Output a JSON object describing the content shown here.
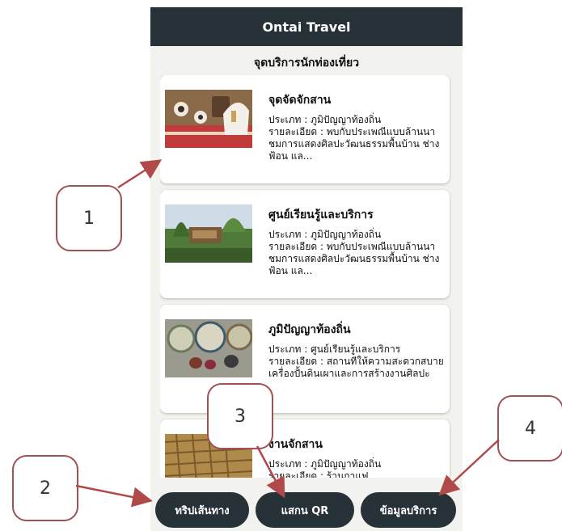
{
  "app": {
    "title": "Ontai Travel"
  },
  "section_title": "จุดบริการนักท่องเที่ยว",
  "cards": [
    {
      "title": "จุดจัดจักสาน",
      "type": "ประเภท : ภูมิปัญญาท้องถิ่น",
      "detail": "รายละเอียด : พบกับประเพณีแบบล้านนา ชมการแสดงศิลปะวัฒนธรรมพื้นบ้าน ช่างฟ้อน แล..."
    },
    {
      "title": "ศูนย์เรียนรู้และบริการ",
      "type": "ประเภท : ภูมิปัญญาท้องถิ่น",
      "detail": "รายละเอียด : พบกับประเพณีแบบล้านนา ชมการแสดงศิลปะวัฒนธรรมพื้นบ้าน ช่างฟ้อน แล..."
    },
    {
      "title": "ภูมิปัญญาท้องถิ่น",
      "type": "ประเภท : ศูนย์เรียนรู้และบริการ",
      "detail": "รายละเอียด : สถานที่ให้ความสะดวกสบาย เครื่องปั้นดินเผาและการสร้างงานศิลปะ"
    },
    {
      "title": "งานจักสาน",
      "type": "ประเภท : ภูมิปัญญาท้องถิ่น",
      "detail": "รายละเอียด : ร้านกาแฟ"
    }
  ],
  "nav": {
    "trip": "ทริปเส้นทาง",
    "scan": "แสกน QR",
    "info": "ข้อมูลบริการ"
  },
  "callouts": [
    "1",
    "2",
    "3",
    "4"
  ],
  "colors": {
    "header_bg": "#273238",
    "callout_border": "#9e5252",
    "arrow": "#b04a4a"
  }
}
